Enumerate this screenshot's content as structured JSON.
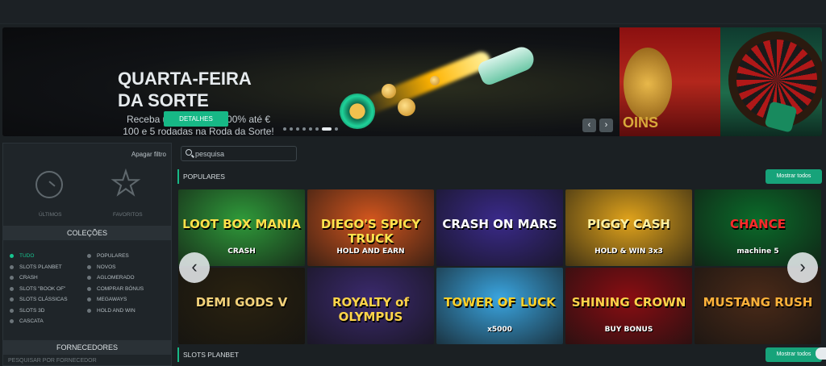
{
  "banner": {
    "title": "QUARTA-FEIRA DA SORTE",
    "subtitle": "Receba um bónus de 100% até € 100 e 5 rodadas na Roda da Sorte!",
    "button": "DETALHES",
    "slide2_text": "OINS",
    "dots_total": 8,
    "active_dot": 7,
    "prev_icon": "chevron-left-icon",
    "next_icon": "chevron-right-icon"
  },
  "sidebar": {
    "clear_filter": "Apagar filtro",
    "recent_label": "ÚLTIMOS",
    "favorites_label": "FAVORITOS",
    "collections_title": "COLEÇÕES",
    "categories": [
      {
        "label": "TUDO",
        "active": true
      },
      {
        "label": "POPULARES",
        "active": false
      },
      {
        "label": "SLOTS PLANBET",
        "active": false
      },
      {
        "label": "NOVOS",
        "active": false
      },
      {
        "label": "CRASH",
        "active": false
      },
      {
        "label": "AGLOMERADO",
        "active": false
      },
      {
        "label": "SLOTS \"BOOK OF\"",
        "active": false
      },
      {
        "label": "COMPRAR BÓNUS",
        "active": false
      },
      {
        "label": "SLOTS CLÁSSICAS",
        "active": false
      },
      {
        "label": "MEGAWAYS",
        "active": false
      },
      {
        "label": "SLOTS 3D",
        "active": false
      },
      {
        "label": "HOLD AND WIN",
        "active": false
      },
      {
        "label": "CASCATA",
        "active": false
      }
    ],
    "providers_title": "FORNECEDORES",
    "providers_placeholder": "PESQUISAR POR FORNECEDOR"
  },
  "search": {
    "placeholder": "pesquisa"
  },
  "sections": [
    {
      "title": "POPULARES",
      "button": "Mostrar todos"
    },
    {
      "title": "SLOTS PLANBET",
      "button": "Mostrar todos"
    }
  ],
  "games": [
    {
      "name": "LOOT BOX MANIA",
      "sub": "CRASH",
      "bg": "#2f9a3a",
      "color": "#ffe14a"
    },
    {
      "name": "DIEGO'S SPICY TRUCK",
      "sub": "HOLD AND EARN",
      "bg": "#d3561e",
      "color": "#ffe24d"
    },
    {
      "name": "CRASH ON MARS",
      "sub": "",
      "bg": "#3a2a8a",
      "color": "#ffffff"
    },
    {
      "name": "PIGGY CASH",
      "sub": "HOLD & WIN 3x3",
      "bg": "#e0a31c",
      "color": "#fff0a0"
    },
    {
      "name": "CHANCE",
      "sub": "machine 5",
      "bg": "#0b6b2a",
      "color": "#ff2a2a"
    },
    {
      "name": "DEMI GODS V",
      "sub": "",
      "bg": "#2a2210",
      "color": "#f3d27a"
    },
    {
      "name": "ROYALTY of OLYMPUS",
      "sub": "",
      "bg": "#3b2a6e",
      "color": "#ffd54a"
    },
    {
      "name": "TOWER OF LUCK",
      "sub": "x5000",
      "bg": "#3aa5e0",
      "color": "#ffd12a"
    },
    {
      "name": "SHINING CROWN",
      "sub": "BUY BONUS",
      "bg": "#8a0d12",
      "color": "#ffd24a"
    },
    {
      "name": "MUSTANG RUSH",
      "sub": "",
      "bg": "#4a2a18",
      "color": "#ffb23a"
    }
  ],
  "nav": {
    "prev": "‹",
    "next": "›"
  }
}
